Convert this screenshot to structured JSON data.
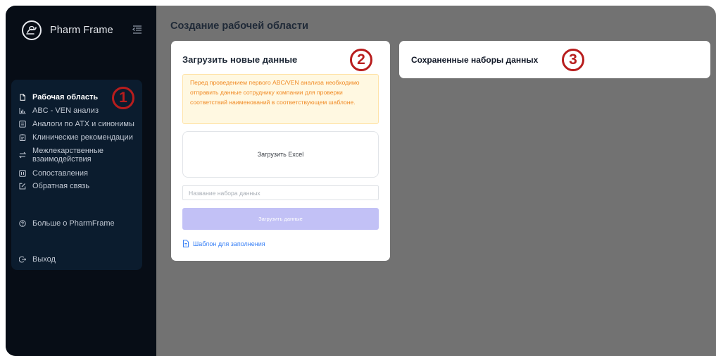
{
  "brand": {
    "name": "Pharm Frame"
  },
  "sidebar": {
    "items": [
      {
        "label": "Рабочая область",
        "icon": "document-icon",
        "active": true
      },
      {
        "label": "ABC - VEN анализ",
        "icon": "bar-chart-icon"
      },
      {
        "label": "Аналоги по АТХ и синонимы",
        "icon": "list-box-icon"
      },
      {
        "label": "Клинические рекомендации",
        "icon": "clipboard-icon"
      },
      {
        "label": "Межлекарственные взаимодействия",
        "icon": "swap-arrows-icon"
      },
      {
        "label": "Сопоставления",
        "icon": "compare-icon"
      },
      {
        "label": "Обратная связь",
        "icon": "edit-icon"
      }
    ],
    "about": {
      "label": "Больше о PharmFrame",
      "icon": "help-circle-icon"
    },
    "logout": {
      "label": "Выход",
      "icon": "logout-icon"
    }
  },
  "main": {
    "title": "Создание рабочей области",
    "upload_card": {
      "title": "Загрузить новые данные",
      "notice": "Перед проведением первого ABC/VEN анализа необходимо отправить данные сотруднику компании для проверки соответствий наименований в соответствующем шаблоне.",
      "dropzone_label": "Загрузить Excel",
      "dataset_name_placeholder": "Название набора данных",
      "dataset_name_value": "",
      "submit_label": "Загрузить данные",
      "template_link": "Шаблон для заполнения"
    },
    "saved_card": {
      "title": "Сохраненные наборы данных"
    }
  },
  "annotations": {
    "badge1": "1",
    "badge2": "2",
    "badge3": "3"
  },
  "colors": {
    "sidebar_bg": "#070d16",
    "menu_panel_bg": "#0b1c2e",
    "main_bg": "#727272",
    "notice_text": "#f08a24",
    "notice_bg": "#fff8e1",
    "button_bg": "#c2c1f6",
    "link": "#3b82f6",
    "badge": "#b81d1d"
  }
}
